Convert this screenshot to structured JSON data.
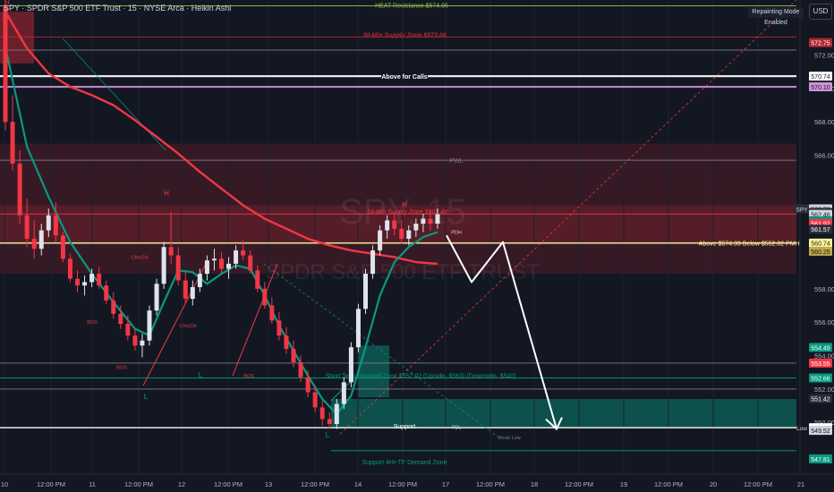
{
  "header": {
    "title": "SPY · SPDR S&P 500 ETF Trust · 15 · NYSE Arca · Heikin Ashi",
    "repainting_badge": "Repainting Mode Enabled",
    "currency_button": "USD",
    "top_label": "HEAT Resistance $574.95"
  },
  "watermark": {
    "ticker": "SPY, 15",
    "name": "SPDR S&P 500 ETF TRUST"
  },
  "chart_data": {
    "type": "candlestick",
    "ylim": [
      546.9,
      575.3
    ],
    "y_ticks": [
      550.0,
      552.0,
      554.0,
      556.0,
      558.0,
      566.0,
      568.0,
      570.0,
      572.0
    ],
    "x_ticks": [
      "10",
      "12:00 PM",
      "11",
      "12:00 PM",
      "12",
      "12:00 PM",
      "13",
      "12:00 PM",
      "14",
      "12:00 PM",
      "17",
      "12:00 PM",
      "18",
      "12:00 PM",
      "19",
      "12:00 PM",
      "20",
      "12:00 PM",
      "21"
    ],
    "price_tags": [
      {
        "value": 572.75,
        "label": "572.75",
        "color": "#b22833"
      },
      {
        "value": 570.74,
        "label": "570.74",
        "color": "#ffffff"
      },
      {
        "value": 570.1,
        "label": "570.10",
        "color": "#ce93d8"
      },
      {
        "value": 562.79,
        "label": "562.79",
        "color": "#d1d4dc"
      },
      {
        "value": 562.58,
        "label": "562.58",
        "color": "#2a2e39"
      },
      {
        "value": 562.46,
        "label": "562.46",
        "color": "#d1d4dc"
      },
      {
        "value": 562.07,
        "label": "562.07",
        "color": "#089981"
      },
      {
        "value": 561.92,
        "label": "561.92",
        "color": "#f23645"
      },
      {
        "value": 561.57,
        "label": "561.57",
        "color": "#2a2e39"
      },
      {
        "value": 560.74,
        "label": "560.74",
        "color": "#fff59d"
      },
      {
        "value": 560.25,
        "label": "560.25",
        "color": "#c2a94c"
      },
      {
        "value": 554.49,
        "label": "554.49",
        "color": "#089981"
      },
      {
        "value": 553.55,
        "label": "553.55",
        "color": "#f23645"
      },
      {
        "value": 552.66,
        "label": "552.66",
        "color": "#089981"
      },
      {
        "value": 551.42,
        "label": "551.42",
        "color": "#2a2e39"
      },
      {
        "value": 549.68,
        "label": "549.68",
        "color": "#ffffff"
      },
      {
        "value": 549.52,
        "label": "549.52",
        "color": "#d1d4dc"
      },
      {
        "value": 547.81,
        "label": "547.81",
        "color": "#089981"
      }
    ],
    "symbol_tag": "SPY",
    "low_tag": "Low",
    "levels": [
      {
        "value": 574.95,
        "label": "HEAT Resistance $574.95",
        "color": "#8bc34a"
      },
      {
        "value": 573.08,
        "label": "30-Min Supply Zone $573.08",
        "color": "#b22833"
      },
      {
        "value": 572.3,
        "label": "",
        "color": "#787b86"
      },
      {
        "value": 570.74,
        "label": "Above for Calls",
        "color": "#ffffff"
      },
      {
        "value": 570.1,
        "label": "",
        "color": "#ce93d8"
      },
      {
        "value": 565.7,
        "label": "PWL",
        "color": "#787b86"
      },
      {
        "value": 562.48,
        "label": "15-Min Supply Zone $562.48",
        "color": "#f23645"
      },
      {
        "value": 560.74,
        "label": "Above $574.39 Below $552.02 PMH 3/13",
        "color": "#fff59d"
      },
      {
        "value": 553.55,
        "label": "",
        "color": "#787b86"
      },
      {
        "value": 552.66,
        "label": "Short Term Demand Zone $552.02 (Upside- $563) (Downside- $540)",
        "color": "#089981"
      },
      {
        "value": 552.0,
        "label": "",
        "color": "#787b86"
      },
      {
        "value": 549.68,
        "label": "Support",
        "color": "#ffffff"
      },
      {
        "value": 548.3,
        "label": "Support 4Hr-TF Demand Zone",
        "color": "#089981"
      }
    ],
    "annotations": [
      "H",
      "H",
      "L",
      "L",
      "L",
      "H",
      "BOS",
      "BOS",
      "BOS",
      "CHoCH",
      "CHoCH",
      "PDH",
      "PDL",
      "Weak Low"
    ],
    "projection": [
      [
        0,
        561.2
      ],
      [
        6,
        558.4
      ],
      [
        10,
        560.8
      ],
      [
        23,
        549.6
      ]
    ],
    "candles": [
      [
        575.0,
        575.3,
        567.5,
        568.0
      ],
      [
        568.0,
        569.6,
        565.1,
        565.5
      ],
      [
        565.5,
        566.3,
        561.9,
        562.4
      ],
      [
        562.4,
        563.4,
        560.5,
        561.0
      ],
      [
        561.0,
        562.1,
        559.8,
        560.4
      ],
      [
        560.4,
        561.9,
        560.0,
        561.5
      ],
      [
        561.5,
        562.8,
        561.1,
        562.4
      ],
      [
        562.4,
        563.2,
        560.8,
        561.2
      ],
      [
        561.2,
        561.4,
        559.6,
        559.8
      ],
      [
        559.8,
        560.1,
        558.4,
        558.6
      ],
      [
        558.6,
        559.1,
        557.8,
        558.2
      ],
      [
        558.2,
        558.8,
        557.6,
        558.4
      ],
      [
        558.4,
        559.2,
        558.1,
        558.9
      ],
      [
        558.9,
        559.3,
        558.0,
        558.2
      ],
      [
        558.2,
        558.5,
        557.1,
        557.3
      ],
      [
        557.3,
        557.8,
        556.2,
        556.5
      ],
      [
        556.5,
        557.0,
        555.6,
        555.9
      ],
      [
        555.9,
        556.4,
        554.9,
        555.2
      ],
      [
        555.2,
        555.6,
        554.3,
        554.6
      ],
      [
        554.6,
        555.3,
        553.9,
        554.9
      ],
      [
        554.9,
        557.0,
        554.6,
        556.7
      ],
      [
        556.7,
        558.6,
        556.4,
        558.3
      ],
      [
        558.3,
        560.8,
        558.0,
        560.5
      ],
      [
        560.5,
        562.6,
        559.5,
        560.0
      ],
      [
        560.0,
        560.5,
        558.2,
        558.5
      ],
      [
        558.5,
        559.0,
        557.1,
        557.4
      ],
      [
        557.4,
        558.5,
        557.0,
        558.1
      ],
      [
        558.1,
        559.2,
        557.8,
        558.9
      ],
      [
        558.9,
        560.0,
        558.5,
        559.7
      ],
      [
        559.7,
        560.4,
        559.1,
        559.8
      ],
      [
        559.8,
        560.2,
        558.9,
        559.2
      ],
      [
        559.2,
        559.9,
        558.6,
        559.5
      ],
      [
        559.5,
        560.6,
        559.2,
        560.3
      ],
      [
        560.3,
        560.9,
        559.7,
        560.0
      ],
      [
        560.0,
        560.3,
        558.9,
        559.1
      ],
      [
        559.1,
        559.4,
        557.8,
        558.0
      ],
      [
        558.0,
        558.4,
        556.8,
        557.0
      ],
      [
        557.0,
        557.5,
        555.9,
        556.1
      ],
      [
        556.1,
        556.6,
        554.9,
        555.2
      ],
      [
        555.2,
        555.7,
        554.1,
        554.4
      ],
      [
        554.4,
        554.9,
        553.3,
        553.6
      ],
      [
        553.6,
        554.0,
        552.4,
        552.7
      ],
      [
        552.7,
        553.1,
        551.5,
        551.8
      ],
      [
        551.8,
        552.2,
        550.6,
        550.9
      ],
      [
        550.9,
        551.3,
        549.8,
        550.2
      ],
      [
        550.2,
        550.6,
        549.6,
        549.9
      ],
      [
        549.9,
        551.4,
        549.6,
        551.1
      ],
      [
        551.1,
        552.7,
        550.8,
        552.4
      ],
      [
        552.4,
        554.8,
        552.1,
        554.5
      ],
      [
        554.5,
        557.1,
        554.2,
        556.8
      ],
      [
        556.8,
        559.2,
        556.5,
        558.9
      ],
      [
        558.9,
        560.6,
        558.6,
        560.3
      ],
      [
        560.3,
        561.8,
        560.0,
        561.5
      ],
      [
        561.5,
        562.4,
        561.0,
        562.1
      ],
      [
        562.1,
        562.6,
        561.2,
        561.6
      ],
      [
        561.6,
        562.1,
        560.7,
        561.0
      ],
      [
        561.0,
        561.8,
        560.6,
        561.5
      ],
      [
        561.5,
        562.2,
        561.1,
        561.9
      ],
      [
        561.9,
        562.5,
        561.4,
        562.2
      ],
      [
        562.2,
        562.7,
        561.5,
        561.9
      ],
      [
        561.9,
        562.8,
        561.6,
        562.46
      ]
    ],
    "ema_slow": [
      [
        0,
        574.6
      ],
      [
        3,
        572.4
      ],
      [
        6,
        570.9
      ],
      [
        9,
        570.1
      ],
      [
        12,
        569.6
      ],
      [
        15,
        569.0
      ],
      [
        18,
        568.1
      ],
      [
        21,
        567.1
      ],
      [
        24,
        566.1
      ],
      [
        27,
        565.0
      ],
      [
        30,
        564.0
      ],
      [
        33,
        563.0
      ],
      [
        36,
        562.2
      ],
      [
        39,
        561.6
      ],
      [
        42,
        561.0
      ],
      [
        45,
        560.6
      ],
      [
        48,
        560.3
      ],
      [
        51,
        560.1
      ],
      [
        54,
        559.9
      ],
      [
        57,
        559.6
      ],
      [
        60,
        559.5
      ]
    ],
    "ema_fast": [
      [
        0,
        572.5
      ],
      [
        3,
        566.5
      ],
      [
        6,
        563.5
      ],
      [
        9,
        560.8
      ],
      [
        12,
        558.9
      ],
      [
        15,
        557.2
      ],
      [
        18,
        555.6
      ],
      [
        20,
        555.2
      ],
      [
        22,
        557.2
      ],
      [
        24,
        559.1
      ],
      [
        26,
        559.0
      ],
      [
        28,
        558.3
      ],
      [
        30,
        558.9
      ],
      [
        32,
        559.4
      ],
      [
        34,
        559.2
      ],
      [
        36,
        557.6
      ],
      [
        38,
        555.8
      ],
      [
        40,
        554.3
      ],
      [
        42,
        552.8
      ],
      [
        44,
        551.4
      ],
      [
        46,
        550.5
      ],
      [
        48,
        551.6
      ],
      [
        50,
        554.5
      ],
      [
        52,
        557.6
      ],
      [
        54,
        559.6
      ],
      [
        56,
        560.5
      ],
      [
        58,
        561.1
      ],
      [
        60,
        561.4
      ]
    ]
  }
}
